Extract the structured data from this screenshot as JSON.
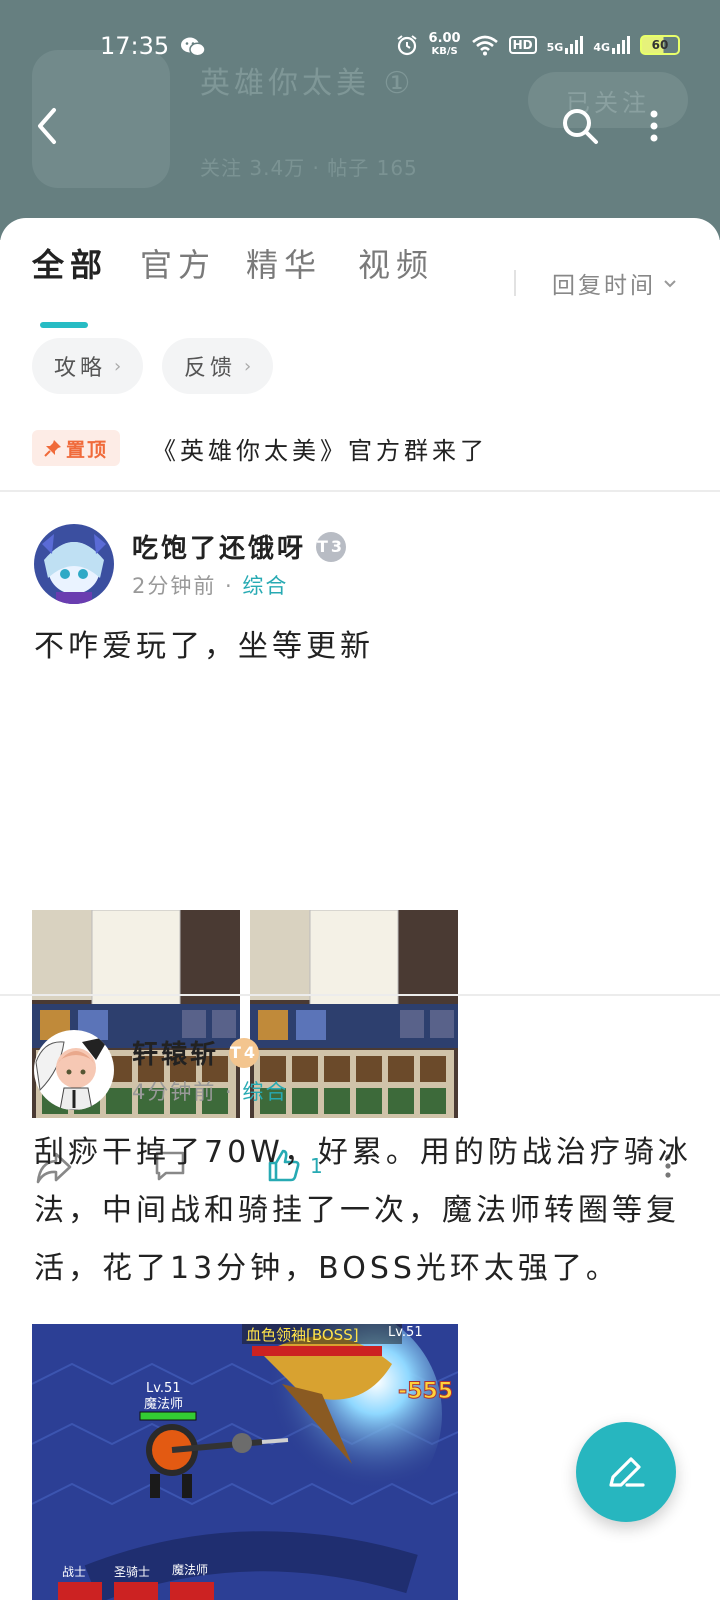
{
  "status_bar": {
    "time": "17:35",
    "speed_value": "6.00",
    "speed_unit": "KB/S",
    "hd_label": "HD",
    "net1_label": "5G",
    "net2_label": "4G",
    "battery": "60"
  },
  "header": {
    "forum_name": "英雄你太美 ①",
    "stats": "关注 3.4万 · 帖子 165",
    "follow_label": "已关注"
  },
  "tabs": [
    {
      "label": "全部"
    },
    {
      "label": "官方"
    },
    {
      "label": "精华"
    },
    {
      "label": "视频"
    }
  ],
  "sort_label": "回复时间",
  "chips": [
    {
      "label": "攻略"
    },
    {
      "label": "反馈"
    }
  ],
  "pinned": {
    "badge": "置顶",
    "title": "《英雄你太美》官方群来了"
  },
  "posts": [
    {
      "author": "吃饱了还饿呀",
      "level": "T3",
      "time": "2分钟前",
      "category": "综合",
      "text": "不咋爱玩了，坐等更新",
      "like_count": "1",
      "accent": "#27aab3"
    },
    {
      "author": "轩辕斩",
      "level": "T4",
      "time": "4分钟前",
      "category": "综合",
      "text": "刮痧干掉了70W，好累。用的防战治疗骑冰法，中间战和骑挂了一次，魔法师转圈等复活，花了13分钟，BOSS光环太强了。",
      "game_labels": {
        "boss": "血色领袖[BOSS]",
        "boss_level": "Lv.51",
        "hero_level": "Lv.51",
        "hero_class": "魔法师",
        "damage": "-555",
        "party": [
          "战士",
          "圣骑士",
          "魔法师"
        ]
      }
    }
  ],
  "colors": {
    "accent": "#27b6bf",
    "header_bg": "#667f80",
    "pin_badge": "#f06a3a"
  }
}
